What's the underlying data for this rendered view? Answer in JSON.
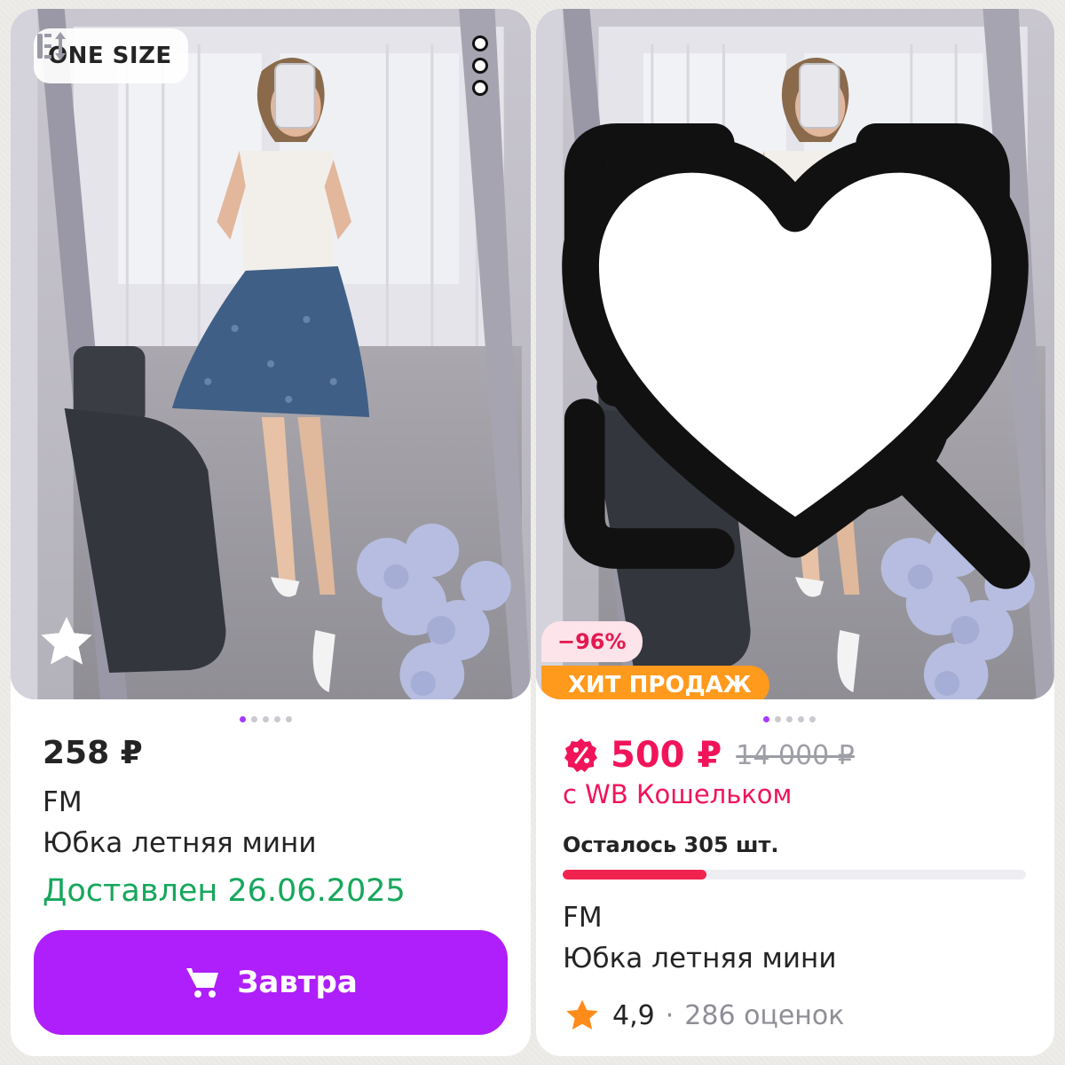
{
  "left_card": {
    "size_badge": "ONE SIZE",
    "rating_stars": 5,
    "carousel": {
      "count": 5,
      "active": 0
    },
    "price": "258 ₽",
    "brand": "FM",
    "name": "Юбка летняя мини",
    "delivery_status": "Доставлен 26.06.2025",
    "cart_button_label": "Завтра",
    "icons": [
      "size-icon",
      "more-vertical-icon",
      "star-icon",
      "cart-icon"
    ]
  },
  "right_card": {
    "discount_badge": "−96%",
    "hit_badge": "ХИТ ПРОДАЖ",
    "carousel": {
      "count": 5,
      "active": 0
    },
    "price": "500 ₽",
    "old_price": "14 000 ₽",
    "wallet_note": "с WB Кошельком",
    "stock_text": "Осталось 305 шт.",
    "stock_progress": 0.31,
    "brand": "FM",
    "name": "Юбка летняя мини",
    "rating": "4,9",
    "rating_separator": "·",
    "reviews_count": "286 оценок",
    "icons": [
      "image-search-icon",
      "heart-icon",
      "percent-badge-icon",
      "star-icon"
    ]
  },
  "colors": {
    "accent_purple": "#ae1ffc",
    "price_pink": "#f1145a",
    "delivered_green": "#16a75c",
    "hit_orange": "#ff9a1d",
    "star_orange": "#ff8c1a"
  }
}
